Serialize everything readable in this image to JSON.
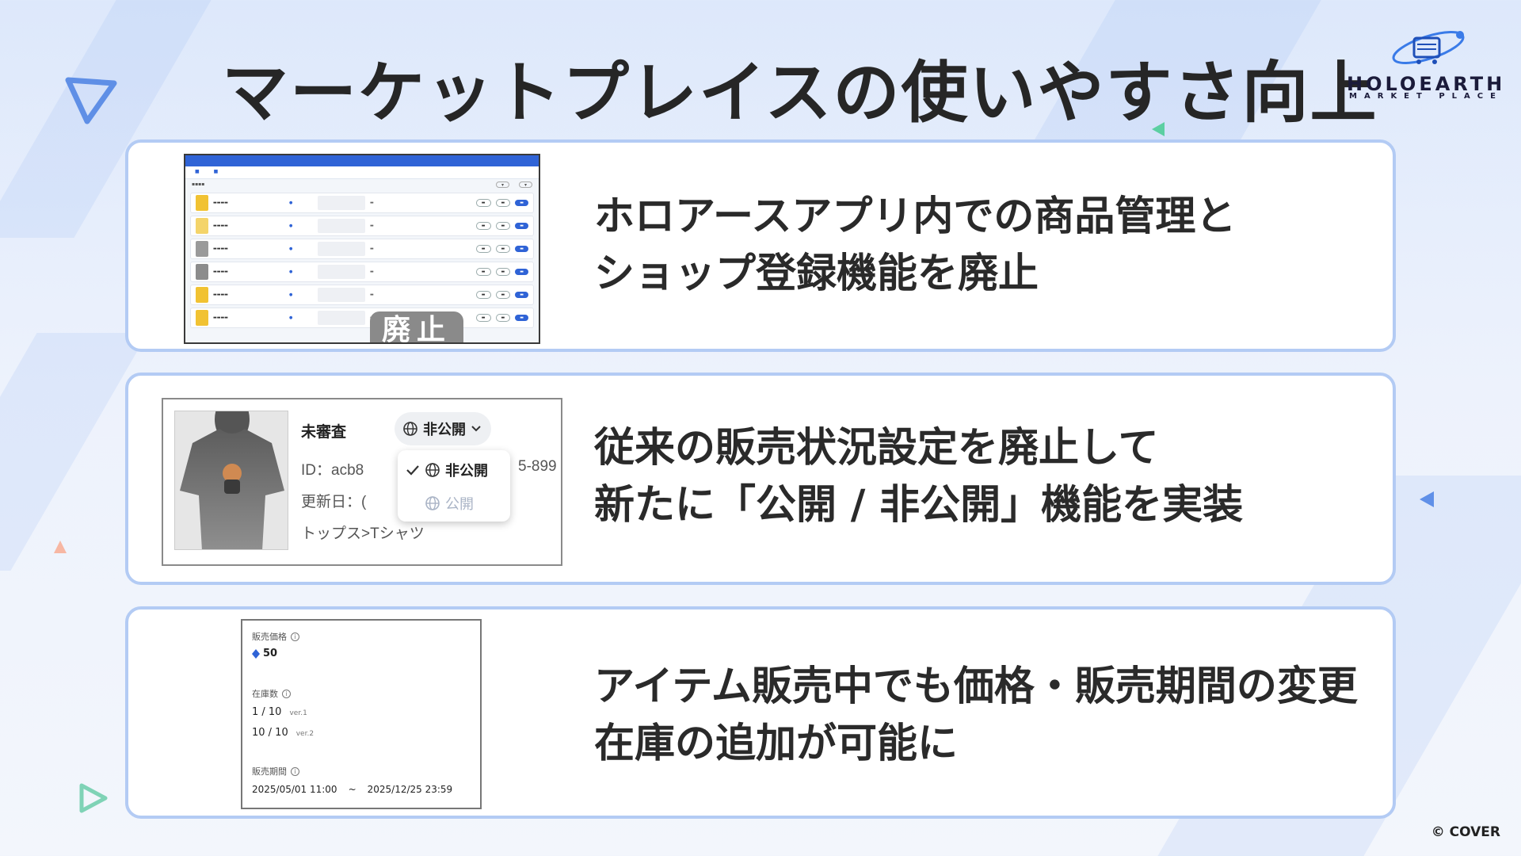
{
  "title": "マーケットプレイスの使いやすさ向上",
  "logo": {
    "name": "HOLOEARTH",
    "sub": "MARKET PLACE"
  },
  "copyright": "© COVER",
  "cards": [
    {
      "lines": [
        "ホロアースアプリ内での商品管理と",
        "ショップ登録機能を廃止"
      ],
      "badge": "廃止"
    },
    {
      "lines": [
        "従来の販売状況設定を廃止して",
        "新たに「公開 / 非公開」機能を実装"
      ]
    },
    {
      "lines": [
        "アイテム販売中でも価格・販売期間の変更",
        "在庫の追加が可能に"
      ]
    }
  ],
  "item_status": {
    "review": "未審査",
    "current": "非公開",
    "options": [
      "非公開",
      "公開"
    ],
    "id_line": "ID：acb8",
    "id_tail": "5-899",
    "updated": "更新日：(",
    "category": "トップス>Tシャツ"
  },
  "item_edit": {
    "price_label": "販売価格",
    "price_value": "50",
    "stock_label": "在庫数",
    "stock": [
      {
        "value": "1 / 10",
        "ver": "ver.1"
      },
      {
        "value": "10 / 10",
        "ver": "ver.2"
      }
    ],
    "period_label": "販売期間",
    "period_start": "2025/05/01 11:00",
    "period_sep": "~",
    "period_end": "2025/12/25 23:59"
  },
  "colors": {
    "card_border": "#b3cbf4",
    "accent_blue": "#2f63d6",
    "badge_gray": "#8a8a8a"
  }
}
